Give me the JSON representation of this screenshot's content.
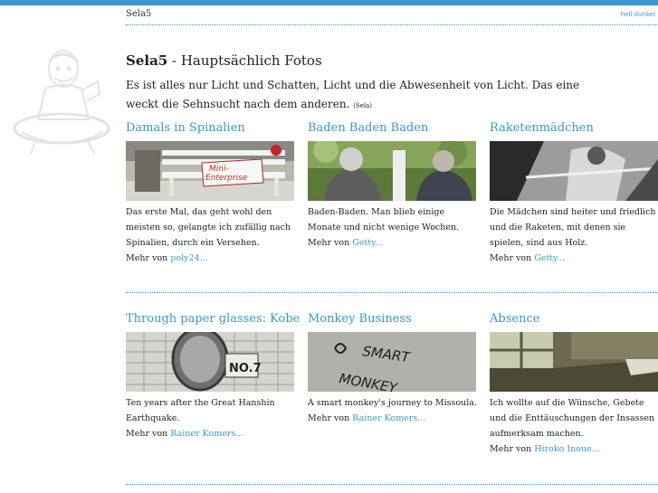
{
  "header": {
    "brand": "Sela5",
    "mode_light": "hell",
    "mode_separator": "·",
    "mode_dark": "dunkel"
  },
  "intro": {
    "title_bold": "Sela5",
    "title_rest": " - Hauptsächlich Fotos",
    "text": "Es ist alles nur Licht und Schatten, Licht und die Abwesenheit von Licht. Das eine weckt die Sehnsucht nach dem anderen.",
    "source": "(Sela)"
  },
  "more_label": "Mehr von",
  "posts": [
    {
      "title": "Damals in Spinalien",
      "text": "Das erste Mal, das geht wohl den meisten so, gelangte ich zufällig nach Spinalien, durch ein Versehen.",
      "author": "poly24...",
      "image_sign": "Mini-Enterprise"
    },
    {
      "title": "Baden Baden Baden",
      "text": "Baden-Baden. Man blieb einige Monate und nicht wenige Wochen.",
      "author": "Getty..."
    },
    {
      "title": "Raketenmädchen",
      "text": "Die Mädchen sind heiter und friedlich und die Raketen, mit denen sie spielen, sind aus Holz.",
      "author": "Getty..."
    },
    {
      "title": "Through paper glasses: Kobe",
      "text": "Ten years after the Great Hanshin Earthquake.",
      "author": "Rainer Komers...",
      "image_sign": "NO.7"
    },
    {
      "title": "Monkey Business",
      "text": "A smart monkey's journey to Missoula.",
      "author": "Rainer Komers...",
      "image_sign": "SMART MONKEY"
    },
    {
      "title": "Absence",
      "text": "Ich wollte auf die Wünsche, Gebete und die Enttäuschungen der Insassen aufmerksam machen.",
      "author": "Hiroko Inoue..."
    }
  ]
}
